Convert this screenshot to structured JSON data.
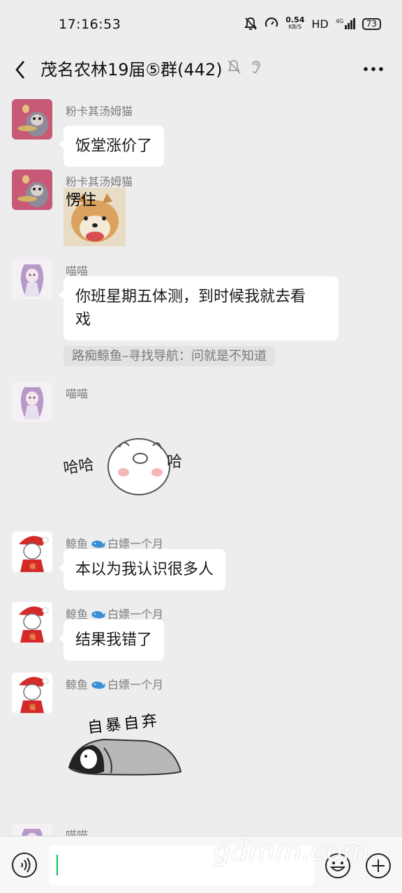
{
  "status_bar": {
    "time": "17:16:53",
    "speed_value": "0.54",
    "speed_unit": "KB/S",
    "hd": "HD",
    "network": "4G",
    "battery": "73"
  },
  "header": {
    "title": "茂名农林19届⑤群(442)"
  },
  "messages": [
    {
      "sender": "粉卡其汤姆猫",
      "text": "饭堂涨价了"
    },
    {
      "sender": "粉卡其汤姆猫",
      "sticker_text": "愣住"
    },
    {
      "sender": "喵喵",
      "text_line1": "你班星期五体测，到时候我就去看",
      "text_line2": "戏",
      "quote": "路痴鲸鱼–寻找导航：问就是不知道"
    },
    {
      "sender": "喵喵",
      "sticker_text": "哈哈哈"
    },
    {
      "sender_name": "鲸鱼",
      "sender_suffix": "白嫖一个月",
      "text": "本以为我认识很多人"
    },
    {
      "sender_name": "鲸鱼",
      "sender_suffix": "白嫖一个月",
      "text": "结果我错了"
    },
    {
      "sender_name": "鲸鱼",
      "sender_suffix": "白嫖一个月",
      "sticker_text": "自暴自弃"
    },
    {
      "sender": "喵喵"
    }
  ],
  "watermark": "gdmm.com",
  "colors": {
    "background": "#ededed",
    "bubble": "#ffffff",
    "caret": "#07c160"
  }
}
